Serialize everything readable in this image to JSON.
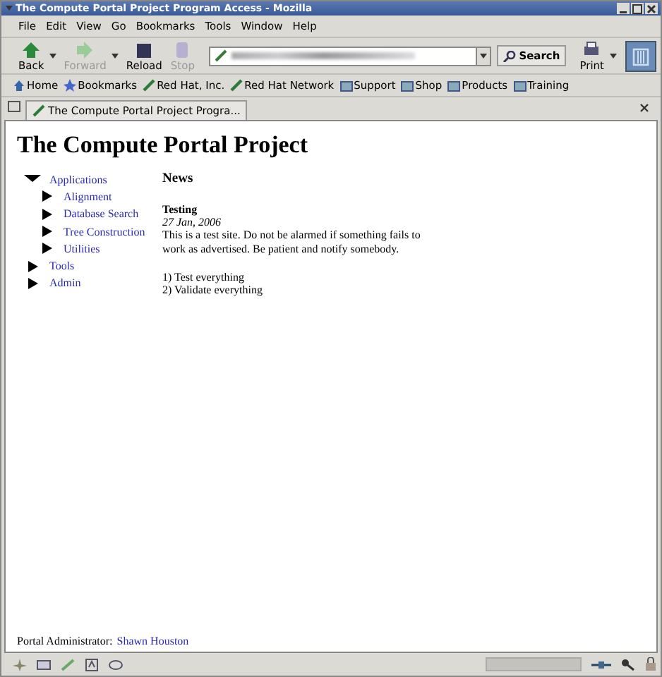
{
  "window": {
    "title": "The Compute Portal Project Program Access - Mozilla"
  },
  "menu": [
    "File",
    "Edit",
    "View",
    "Go",
    "Bookmarks",
    "Tools",
    "Window",
    "Help"
  ],
  "toolbar": [
    {
      "label": "Back",
      "disabled": false,
      "dropdown": true
    },
    {
      "label": "Forward",
      "disabled": true,
      "dropdown": true
    },
    {
      "label": "Reload",
      "disabled": false,
      "dropdown": false
    },
    {
      "label": "Stop",
      "disabled": true,
      "dropdown": false
    }
  ],
  "search_button": "Search",
  "print_button": "Print",
  "bookmarks": [
    {
      "label": "Home",
      "kind": "home"
    },
    {
      "label": "Bookmarks",
      "kind": "bookmarks"
    },
    {
      "label": "Red Hat, Inc.",
      "kind": "link"
    },
    {
      "label": "Red Hat Network",
      "kind": "link"
    },
    {
      "label": "Support",
      "kind": "folder"
    },
    {
      "label": "Shop",
      "kind": "folder"
    },
    {
      "label": "Products",
      "kind": "folder"
    },
    {
      "label": "Training",
      "kind": "folder"
    }
  ],
  "tabs": [
    {
      "label": "The Compute Portal Project Progra...",
      "selected": true
    }
  ],
  "page": {
    "heading": "The Compute Portal Project",
    "nav": [
      {
        "label": "Applications",
        "expanded": true,
        "children": [
          {
            "label": "Alignment",
            "expanded": false
          },
          {
            "label": "Database Search",
            "expanded": false
          },
          {
            "label": "Tree Construction",
            "expanded": false
          },
          {
            "label": "Utilities",
            "expanded": false
          }
        ]
      },
      {
        "label": "Tools",
        "expanded": false
      },
      {
        "label": "Admin",
        "expanded": false
      }
    ],
    "section_title": "News",
    "news": {
      "title": "Testing",
      "date": "27 Jan, 2006",
      "body": "This is a test site. Do not be alarmed if something fails to work as advertised. Be patient and notify somebody.",
      "items": [
        "1) Test everything",
        "2) Validate everything"
      ]
    },
    "footer": {
      "label": "Portal Administrator:",
      "link": "Shawn Houston"
    }
  }
}
